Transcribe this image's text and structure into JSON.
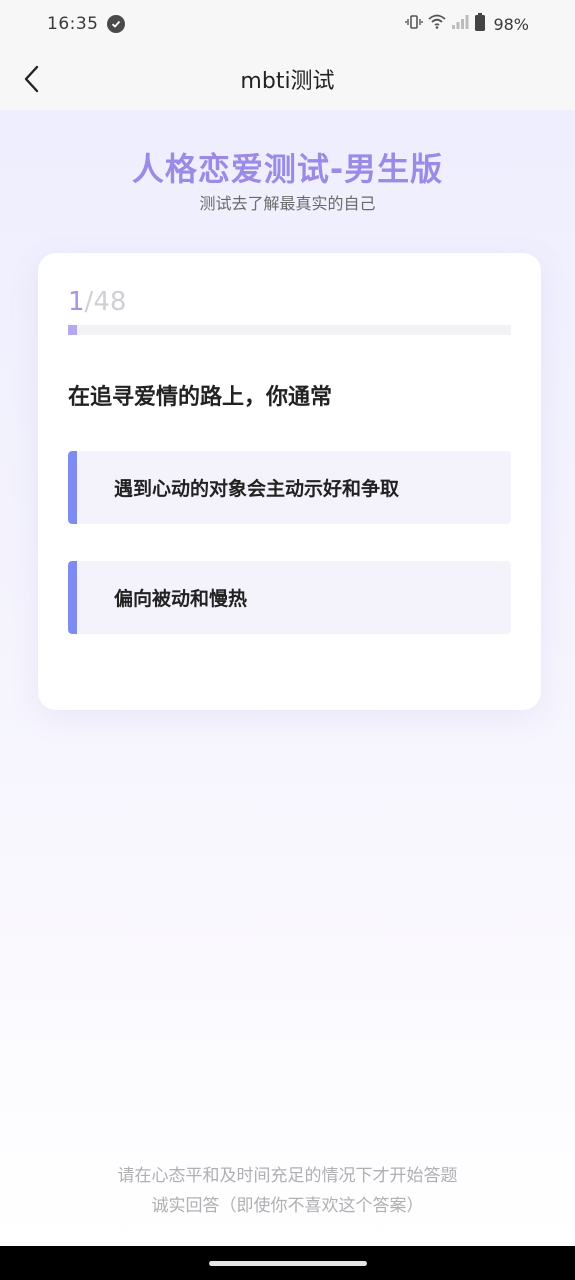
{
  "status_bar": {
    "time": "16:35",
    "battery": "98%",
    "icons": [
      "check-circle-icon",
      "vibrate-icon",
      "wifi-icon",
      "signal-icon",
      "battery-icon"
    ]
  },
  "nav": {
    "title": "mbti测试",
    "back_icon": "back-arrow-icon"
  },
  "header": {
    "title": "人格恋爱测试-男生版",
    "subtitle": "测试去了解最真实的自己"
  },
  "quiz": {
    "current": "1",
    "separator": "/",
    "total": "48",
    "progress": 0.02,
    "question": "在追寻爱情的路上，你通常",
    "options": [
      {
        "label": "遇到心动的对象会主动示好和争取"
      },
      {
        "label": "偏向被动和慢热"
      }
    ]
  },
  "footer": {
    "note1": "请在心态平和及时间充足的情况下才开始答题",
    "note2": "诚实回答（即使你不喜欢这个答案）"
  },
  "colors": {
    "accent": "#9b8ae6",
    "option_bar": "#7e8cf2",
    "option_bg": "#f4f3fc"
  }
}
